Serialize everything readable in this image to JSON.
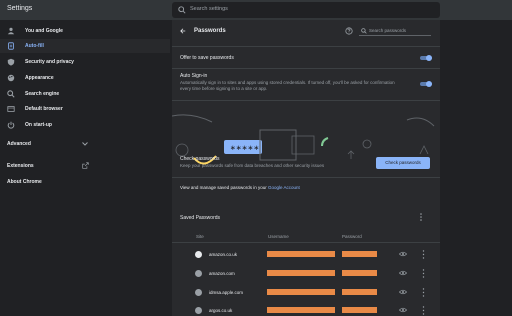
{
  "app": {
    "title": "Settings"
  },
  "search": {
    "placeholder": "Search settings"
  },
  "sidebar": {
    "items": [
      {
        "label": "You and Google",
        "icon": "person-icon",
        "active": false
      },
      {
        "label": "Auto-fill",
        "icon": "autofill-icon",
        "active": true
      },
      {
        "label": "Security and privacy",
        "icon": "shield-icon",
        "active": false
      },
      {
        "label": "Appearance",
        "icon": "palette-icon",
        "active": false
      },
      {
        "label": "Search engine",
        "icon": "search-icon",
        "active": false
      },
      {
        "label": "Default browser",
        "icon": "browser-icon",
        "active": false
      },
      {
        "label": "On start-up",
        "icon": "power-icon",
        "active": false
      }
    ],
    "advanced": "Advanced",
    "extensions": "Extensions",
    "about": "About Chrome"
  },
  "passwords": {
    "title": "Passwords",
    "search_placeholder": "Search passwords",
    "offer_to_save": {
      "label": "Offer to save passwords",
      "enabled": true
    },
    "auto_signin": {
      "label": "Auto Sign-in",
      "description": "Automatically sign in to sites and apps using stored credentials. If turned off, you'll be asked for confirmation every time before signing in to a site or app.",
      "enabled": true
    },
    "check": {
      "label": "Check passwords",
      "description": "Keep your passwords safe from data breaches and other security issues",
      "button": "Check passwords"
    },
    "manage": {
      "text": "View and manage saved passwords in your ",
      "link": "Google Account"
    },
    "saved": {
      "title": "Saved Passwords",
      "columns": {
        "site": "Site",
        "username": "Username",
        "password": "Password"
      },
      "rows": [
        {
          "site": "amazon.co.uk"
        },
        {
          "site": "amazon.com"
        },
        {
          "site": "idmsa.apple.com"
        },
        {
          "site": "argos.co.uk"
        }
      ]
    }
  },
  "colors": {
    "accent": "#8ab4f8",
    "redaction": "#e98a47",
    "background": "#202124",
    "card": "#292a2d"
  }
}
